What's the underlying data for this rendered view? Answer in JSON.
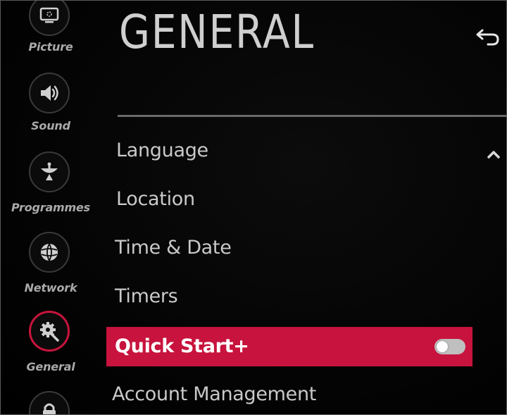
{
  "header": {
    "title": "GENERAL"
  },
  "sidebar": {
    "items": [
      {
        "label": "Picture",
        "icon": "picture-icon",
        "active": false
      },
      {
        "label": "Sound",
        "icon": "speaker-icon",
        "active": false
      },
      {
        "label": "Programmes",
        "icon": "satellite-dish-icon",
        "active": false
      },
      {
        "label": "Network",
        "icon": "globe-icon",
        "active": false
      },
      {
        "label": "General",
        "icon": "gear-wrench-icon",
        "active": true
      },
      {
        "label": "",
        "icon": "lock-icon",
        "active": false
      }
    ]
  },
  "menu": {
    "items": [
      {
        "label": "Language"
      },
      {
        "label": "Location"
      },
      {
        "label": "Time & Date"
      },
      {
        "label": "Timers"
      },
      {
        "label": "Quick Start+",
        "selected": true,
        "toggle": "off"
      },
      {
        "label": "Account Management"
      }
    ]
  },
  "colors": {
    "accent": "#c7133d",
    "background": "#000000",
    "text": "#c9c9c9"
  }
}
